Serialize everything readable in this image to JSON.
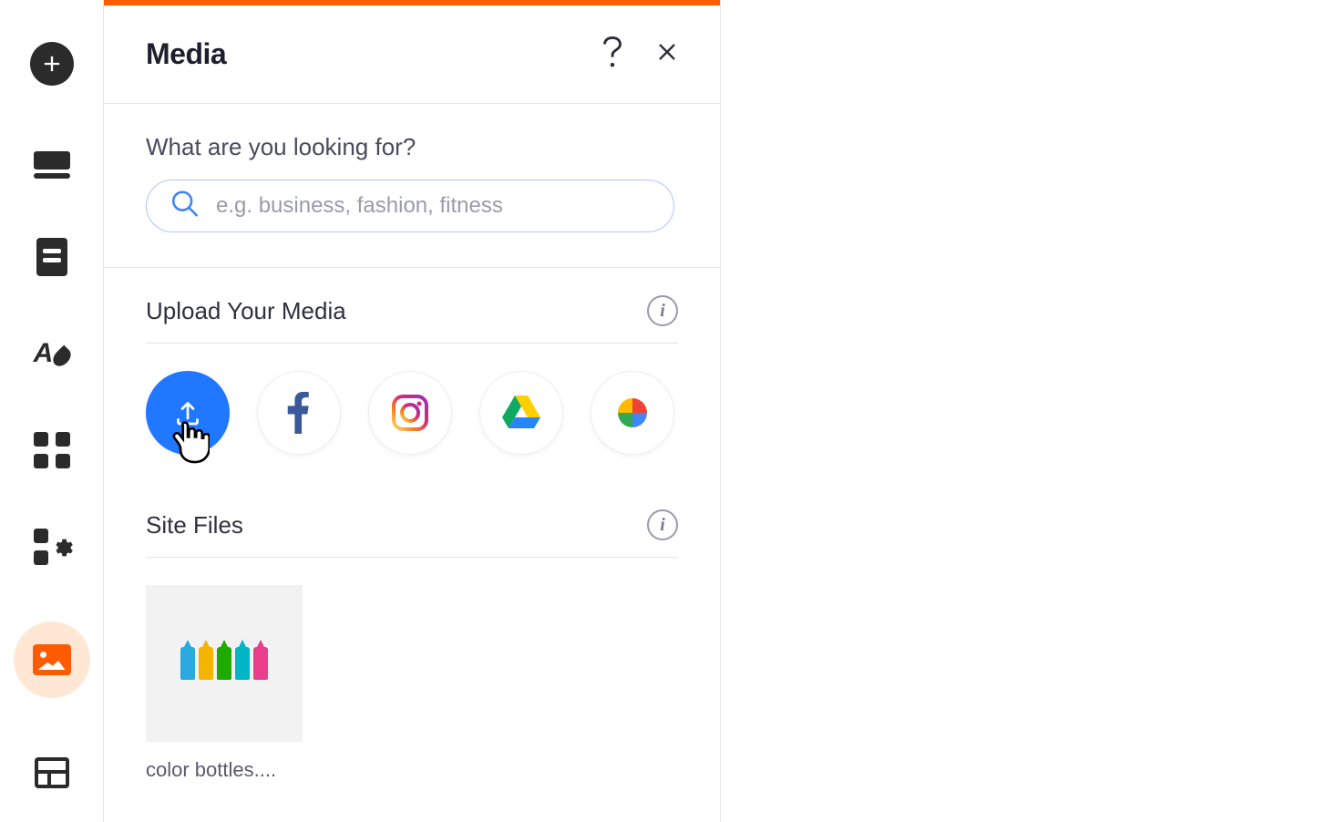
{
  "panel": {
    "title": "Media",
    "help_tooltip": "?",
    "close_tooltip": "Close"
  },
  "search": {
    "label": "What are you looking for?",
    "placeholder": "e.g. business, fashion, fitness"
  },
  "upload": {
    "title": "Upload Your Media",
    "sources": [
      {
        "id": "upload",
        "label": "Upload"
      },
      {
        "id": "facebook",
        "label": "Facebook"
      },
      {
        "id": "instagram",
        "label": "Instagram"
      },
      {
        "id": "google-drive",
        "label": "Google Drive"
      },
      {
        "id": "google-photos",
        "label": "Google Photos"
      }
    ]
  },
  "site_files": {
    "title": "Site Files",
    "items": [
      {
        "name": "color bottles...."
      }
    ]
  },
  "rail": {
    "items": [
      {
        "id": "add",
        "label": "Add"
      },
      {
        "id": "section",
        "label": "Section"
      },
      {
        "id": "pages",
        "label": "Pages"
      },
      {
        "id": "theme",
        "label": "Theme"
      },
      {
        "id": "apps",
        "label": "Apps"
      },
      {
        "id": "app-settings",
        "label": "App Settings"
      },
      {
        "id": "media",
        "label": "Media"
      },
      {
        "id": "data",
        "label": "Content Manager"
      }
    ]
  },
  "colors": {
    "accent": "#ff5b00",
    "primary_blue": "#1f78ff",
    "bottles": [
      "#2aa9e0",
      "#f4b400",
      "#1faa00",
      "#00b5c6",
      "#e83e8c"
    ]
  }
}
